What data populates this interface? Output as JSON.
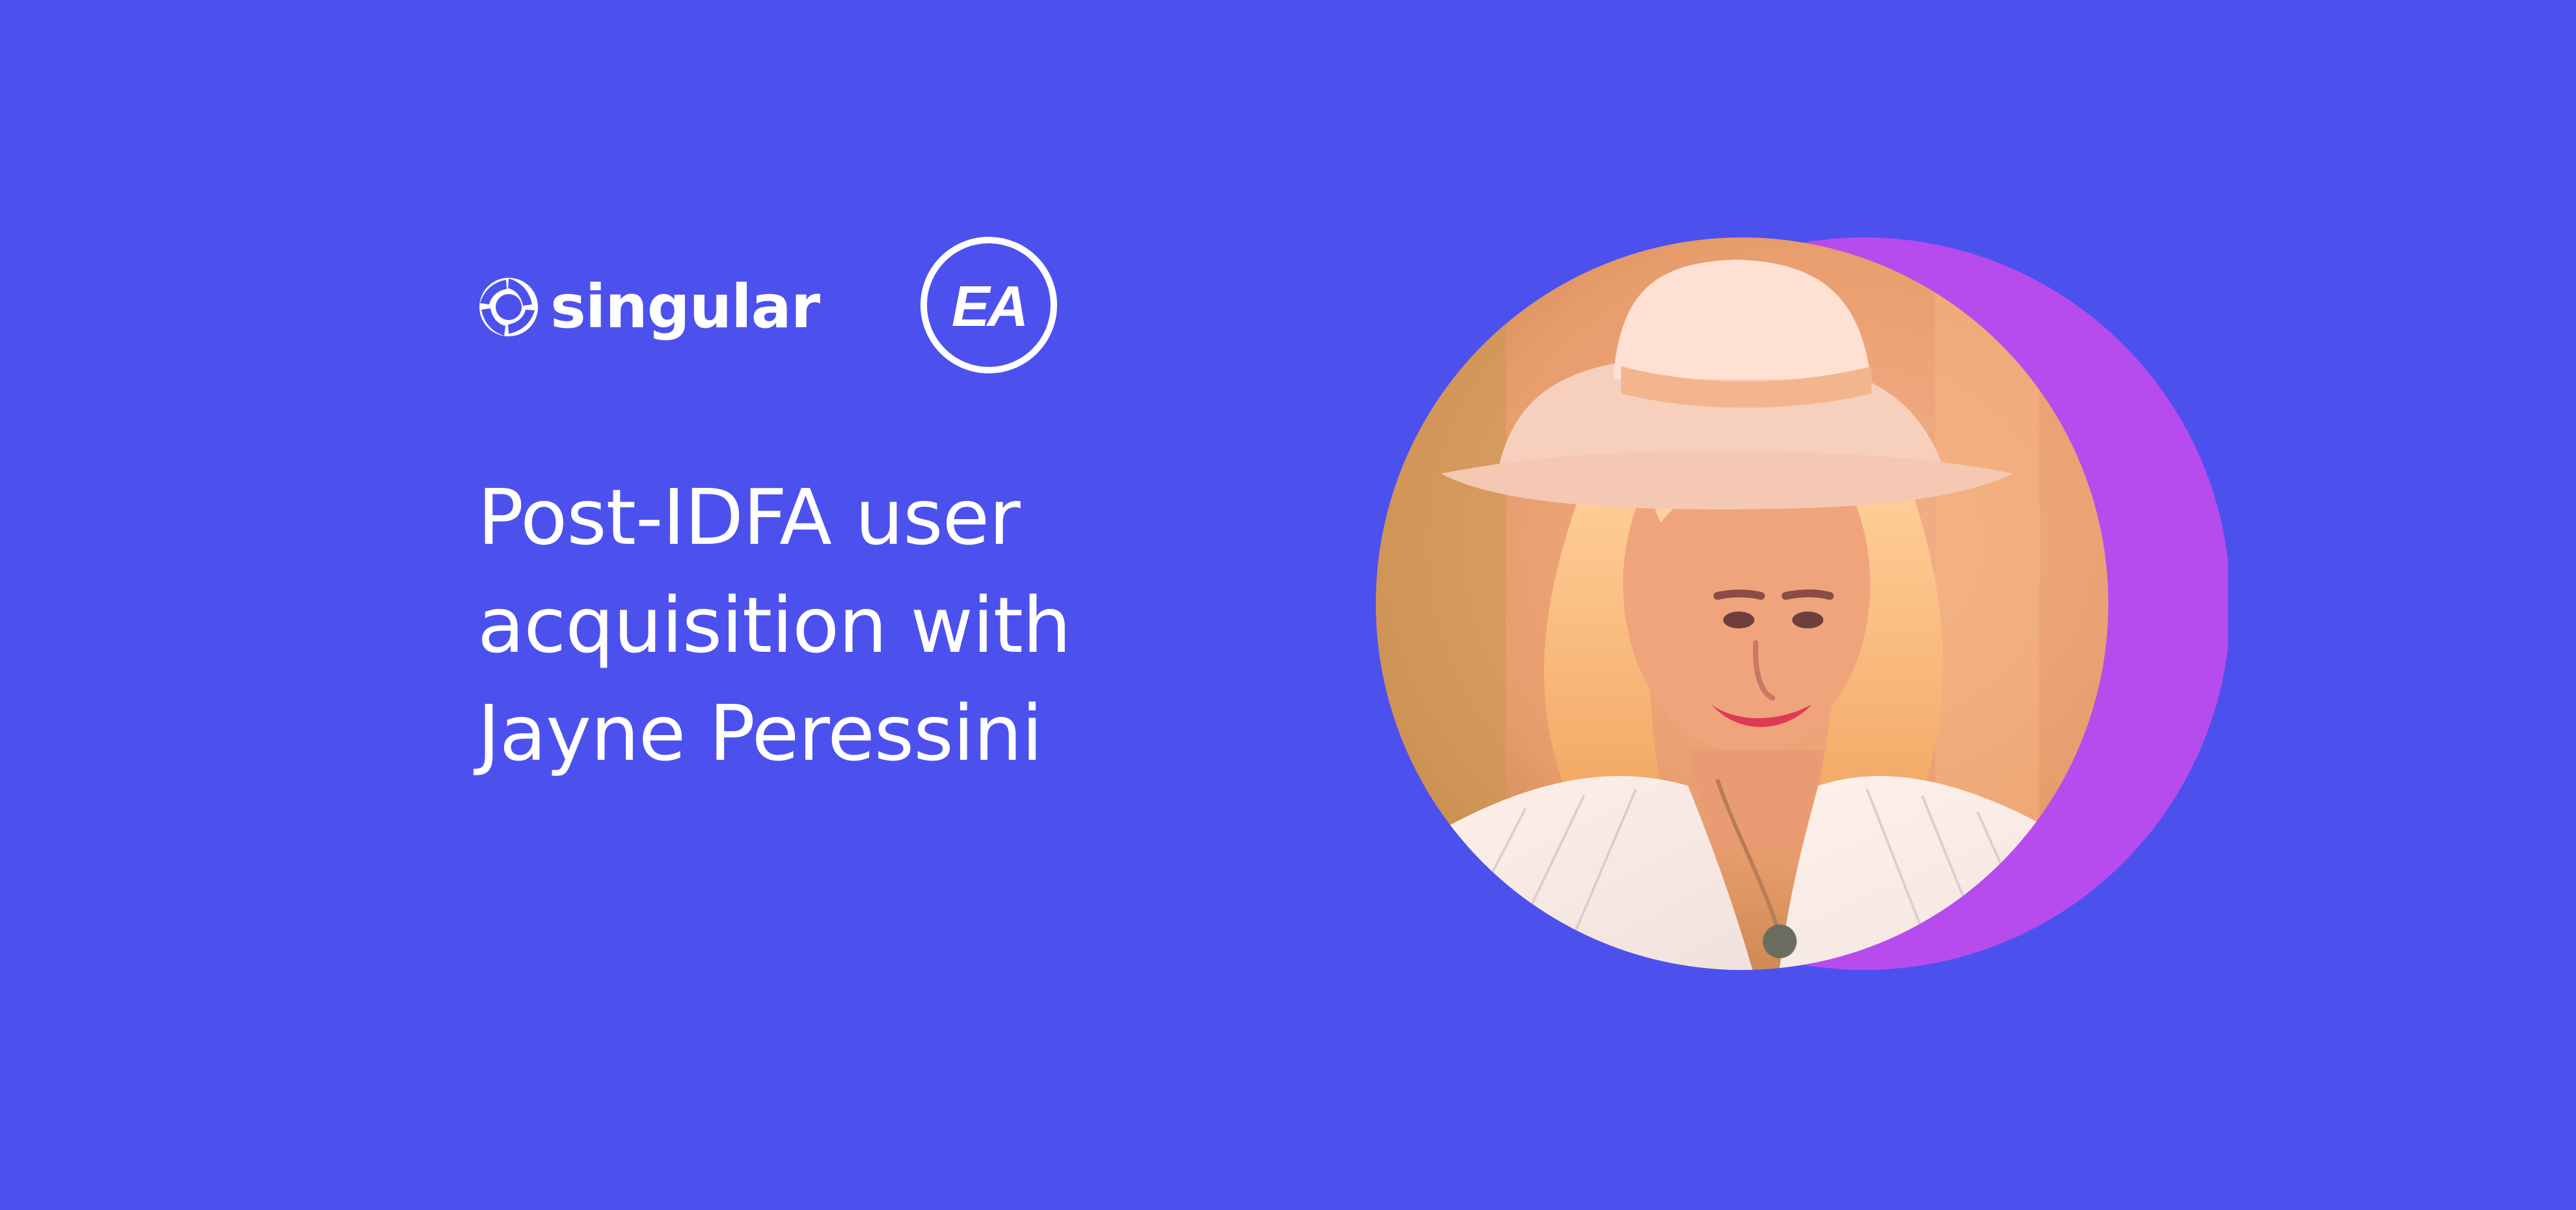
{
  "brand": {
    "singular_wordmark": "singular",
    "ea_wordmark": "EA",
    "singular_icon": "singular-aperture-icon",
    "ea_icon": "ea-circle-logo"
  },
  "headline": {
    "lines": [
      "Post-IDFA user",
      "acquisition with",
      "Jayne Peressini"
    ]
  },
  "portrait": {
    "subject": "Jayne Peressini"
  },
  "colors": {
    "background": "#4c51ee",
    "accent_circle": "#b64ced",
    "text": "#ffffff",
    "portrait_tint": "#f0a37c"
  }
}
